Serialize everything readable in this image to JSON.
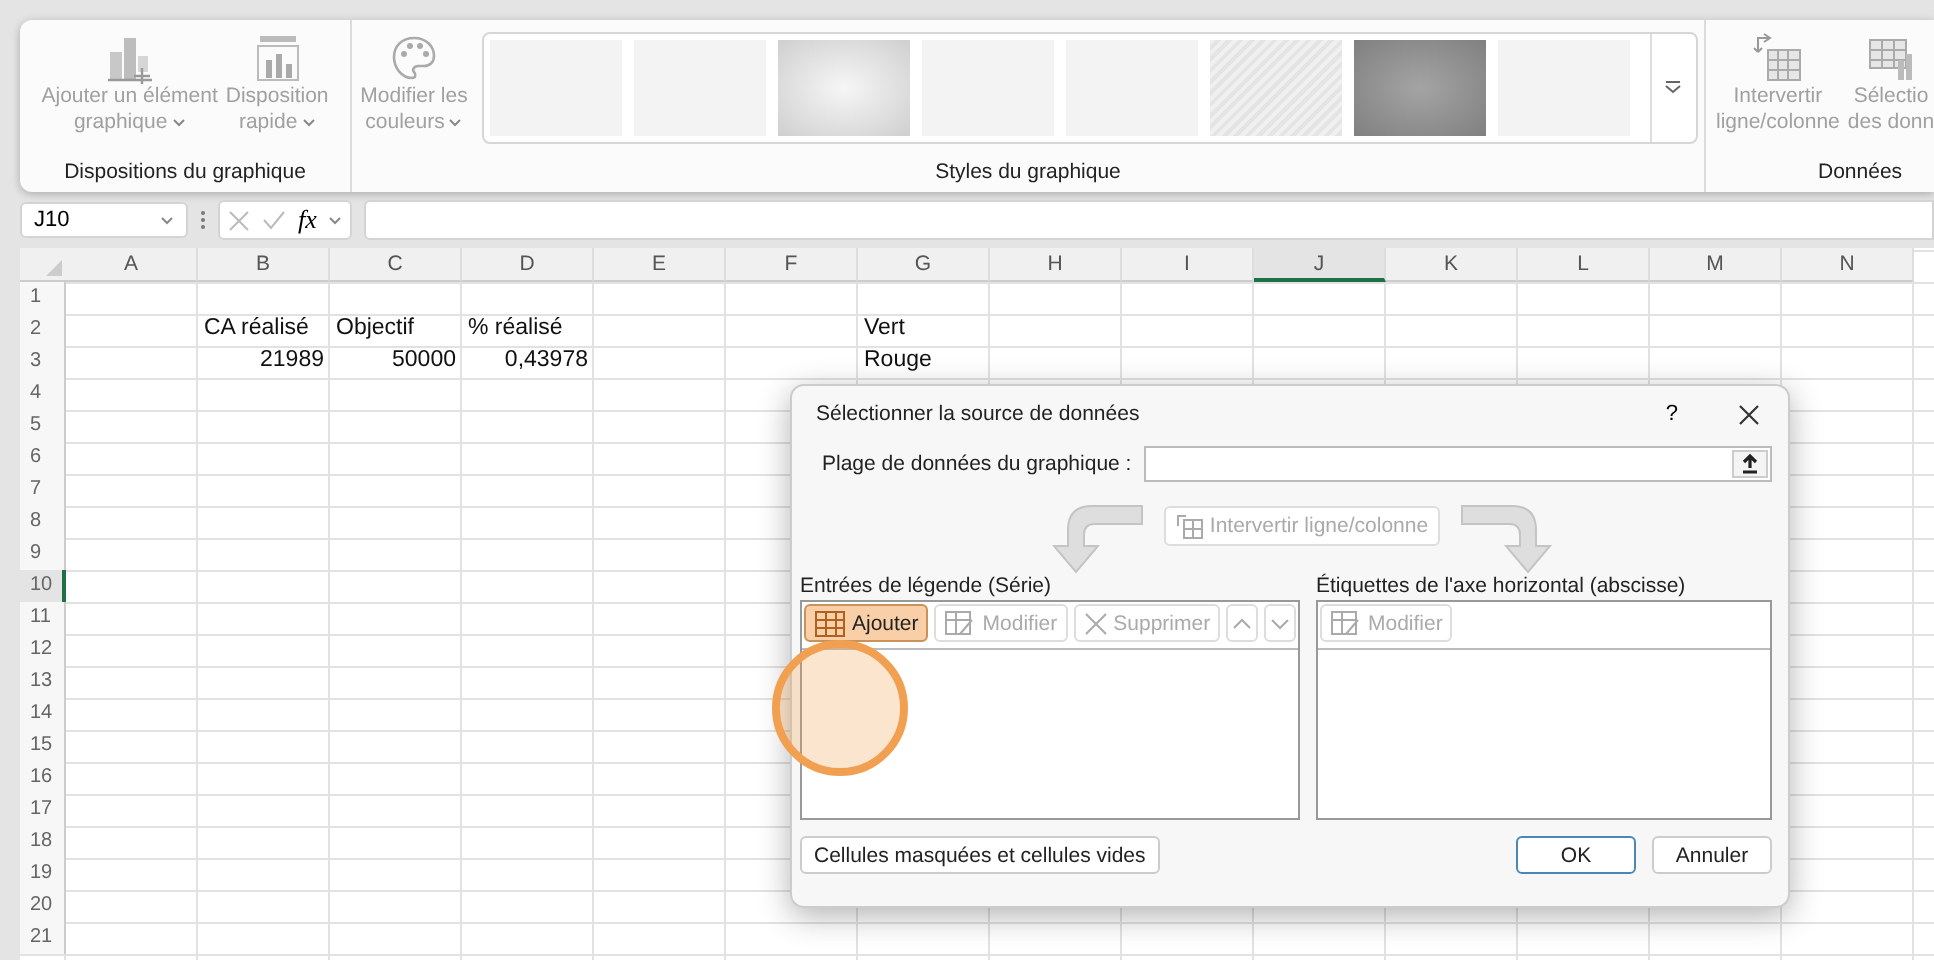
{
  "ribbon": {
    "groups": [
      {
        "label": "Dispositions du graphique",
        "buttons": [
          {
            "kind": "add-element",
            "lines": [
              "Ajouter un élément",
              "graphique"
            ],
            "dropdown": true,
            "disabled": true
          },
          {
            "kind": "layout",
            "lines": [
              "Disposition",
              "rapide"
            ],
            "dropdown": true,
            "disabled": true
          }
        ]
      },
      {
        "label": "Styles du graphique",
        "buttons": [
          {
            "kind": "colors",
            "lines": [
              "Modifier les",
              "couleurs"
            ],
            "dropdown": true,
            "disabled": true
          }
        ],
        "gallery": [
          {
            "kind": "plain"
          },
          {
            "kind": "plain"
          },
          {
            "kind": "gradient"
          },
          {
            "kind": "plain"
          },
          {
            "kind": "plain"
          },
          {
            "kind": "hatched"
          },
          {
            "kind": "dark"
          },
          {
            "kind": "plain"
          }
        ]
      },
      {
        "label": "Données",
        "buttons": [
          {
            "kind": "switch",
            "lines": [
              "Intervertir",
              "ligne/colonne"
            ],
            "dropdown": false,
            "disabled": true
          },
          {
            "kind": "select-data",
            "lines": [
              "Sélectio",
              "des donn"
            ],
            "dropdown": false,
            "disabled": true
          }
        ]
      }
    ]
  },
  "formula_bar": {
    "name_box": "J10",
    "fx": "fx"
  },
  "columns": [
    {
      "label": "A",
      "selected": false
    },
    {
      "label": "B",
      "selected": false
    },
    {
      "label": "C",
      "selected": false
    },
    {
      "label": "D",
      "selected": false
    },
    {
      "label": "E",
      "selected": false
    },
    {
      "label": "F",
      "selected": false
    },
    {
      "label": "G",
      "selected": false
    },
    {
      "label": "H",
      "selected": false
    },
    {
      "label": "I",
      "selected": false
    },
    {
      "label": "J",
      "selected": true
    },
    {
      "label": "K",
      "selected": false
    },
    {
      "label": "L",
      "selected": false
    },
    {
      "label": "M",
      "selected": false
    },
    {
      "label": "N",
      "selected": false
    }
  ],
  "rows": [
    {
      "label": "1",
      "selected": false
    },
    {
      "label": "2",
      "selected": false,
      "cells": [
        {},
        {
          "text": "CA réalisé",
          "kind": "text"
        },
        {
          "text": "Objectif",
          "kind": "text"
        },
        {
          "text": "% réalisé",
          "kind": "text"
        },
        {},
        {},
        {
          "text": "Vert",
          "kind": "text"
        }
      ]
    },
    {
      "label": "3",
      "selected": false,
      "cells": [
        {},
        {
          "text": "21989",
          "kind": "number"
        },
        {
          "text": "50000",
          "kind": "number"
        },
        {
          "text": "0,43978",
          "kind": "number"
        },
        {},
        {},
        {
          "text": "Rouge",
          "kind": "text"
        }
      ]
    },
    {
      "label": "4",
      "selected": false
    },
    {
      "label": "5",
      "selected": false
    },
    {
      "label": "6",
      "selected": false
    },
    {
      "label": "7",
      "selected": false
    },
    {
      "label": "8",
      "selected": false
    },
    {
      "label": "9",
      "selected": false
    },
    {
      "label": "10",
      "selected": true
    },
    {
      "label": "11",
      "selected": false
    },
    {
      "label": "12",
      "selected": false
    },
    {
      "label": "13",
      "selected": false
    },
    {
      "label": "14",
      "selected": false
    },
    {
      "label": "15",
      "selected": false
    },
    {
      "label": "16",
      "selected": false
    },
    {
      "label": "17",
      "selected": false
    },
    {
      "label": "18",
      "selected": false
    },
    {
      "label": "19",
      "selected": false
    },
    {
      "label": "20",
      "selected": false
    },
    {
      "label": "21",
      "selected": false
    }
  ],
  "dialog": {
    "title": "Sélectionner la source de données",
    "help": "?",
    "range_label": "Plage de données du graphique :",
    "switch_button": {
      "label": "Intervertir ligne/colonne",
      "disabled": true
    },
    "series_panel": {
      "label": "Entrées de légende (Série)",
      "buttons": [
        {
          "kind": "add",
          "label": "Ajouter",
          "disabled": false
        },
        {
          "kind": "edit",
          "label": "Modifier",
          "disabled": true
        },
        {
          "kind": "delete",
          "label": "Supprimer",
          "disabled": true
        },
        {
          "kind": "up",
          "disabled": true
        },
        {
          "kind": "down",
          "disabled": true
        }
      ]
    },
    "axis_panel": {
      "label": "Étiquettes de l'axe horizontal (abscisse)",
      "buttons": [
        {
          "kind": "edit",
          "label": "Modifier",
          "disabled": true
        }
      ]
    },
    "hidden_cells_button": "Cellules masquées et cellules vides",
    "ok": "OK",
    "cancel": "Annuler"
  }
}
